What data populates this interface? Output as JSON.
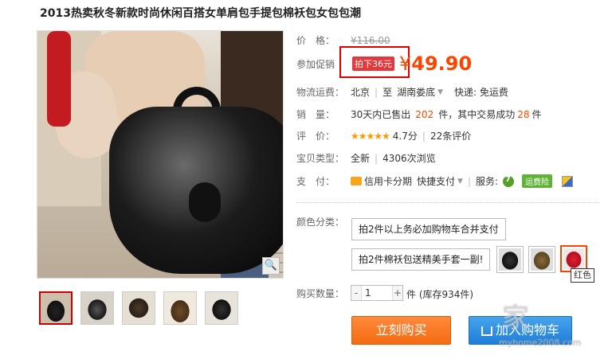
{
  "product": {
    "title": "2013热卖秋冬新款时尚休闲百搭女单肩包手提包棉袄包女包包潮"
  },
  "price": {
    "label": "价　格：",
    "original": "¥116.00",
    "promo_label": "参加促销",
    "promo_tag": "拍下36元",
    "yen": "¥",
    "promo_price": "49.90"
  },
  "shipping": {
    "label": "物流运费：",
    "from": "北京",
    "to_sep": "至",
    "to": "湖南娄底",
    "fee": "快递: 免运费"
  },
  "sales": {
    "label": "销　量：",
    "prefix": "30天内已售出",
    "sold": "202",
    "mid": "件，其中交易成功",
    "success": "28",
    "suffix": "件"
  },
  "rating": {
    "label": "评　价：",
    "stars": "★★★★★",
    "score": "4.7分",
    "reviews": "22条评价"
  },
  "item_type": {
    "label": "宝贝类型：",
    "condition": "全新",
    "views": "4306次浏览"
  },
  "payment": {
    "label": "支　付：",
    "credit": "信用卡分期",
    "quick": "快捷支付",
    "service_label": "服务:",
    "service_tag": "运费险"
  },
  "color": {
    "label": "颜色分类：",
    "option1": "拍2件以上务必加购物车合并支付",
    "option2": "拍2件棉袄包送精美手套一副!",
    "tooltip": "红色"
  },
  "quantity": {
    "label": "购买数量：",
    "minus": "-",
    "value": "1",
    "plus": "+",
    "stock": "件 (库存934件)"
  },
  "actions": {
    "buy": "立刻购买",
    "cart": "加入购物车"
  },
  "watermark": {
    "text": "家",
    "url": "myhome2008.com"
  },
  "colors": {
    "accent": "#ff4400",
    "buy_button": "#f46b11",
    "cart_button": "#1f7fd8",
    "promo_border": "#dd0000"
  }
}
